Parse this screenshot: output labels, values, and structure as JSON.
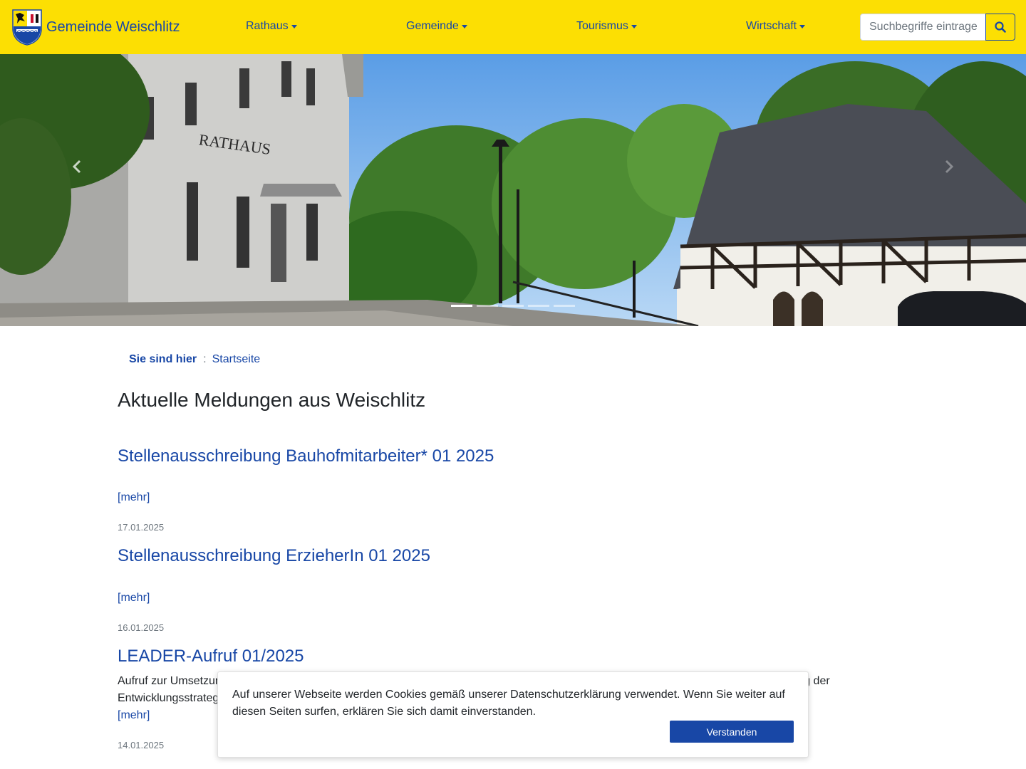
{
  "site": {
    "name": "Gemeinde Weischlitz"
  },
  "nav": {
    "items": [
      {
        "label": "Rathaus"
      },
      {
        "label": "Gemeinde"
      },
      {
        "label": "Tourismus"
      },
      {
        "label": "Wirtschaft"
      }
    ]
  },
  "search": {
    "placeholder": "Suchbegriffe eintragen",
    "icon": "search-icon"
  },
  "carousel": {
    "sign_text": "RATHAUS",
    "slide_count": 5,
    "active_slide": 1
  },
  "breadcrumb": {
    "label": "Sie sind hier",
    "separator": ":",
    "current": "Startseite"
  },
  "main": {
    "title": "Aktuelle Meldungen aus Weischlitz",
    "news": [
      {
        "title": "Stellenausschreibung Bauhofmitarbeiter* 01 2025",
        "text": "",
        "more": "[mehr]",
        "date": "17.01.2025"
      },
      {
        "title": "Stellenausschreibung ErzieherIn 01 2025",
        "text": "",
        "more": "[mehr]",
        "date": "16.01.2025"
      },
      {
        "title": "LEADER-Aufruf 01/2025",
        "text": "Aufruf zur Umsetzung von Vorhaben zur ländlichen Entwicklung. Die Lokale Aktionsgruppe Vogtland ruft auf, sich aktiv an der Umsetzung der Entwicklungsstrategie zu beteiligen.",
        "more": "[mehr]",
        "date": "14.01.2025"
      }
    ]
  },
  "cookie": {
    "text": "Auf unserer Webseite werden Cookies gemäß unserer Datenschutzerklärung verwendet. Wenn Sie weiter auf diesen Seiten surfen, erklären Sie sich damit einverstanden.",
    "button": "Verstanden"
  },
  "colors": {
    "navbar": "#fcdf03",
    "link": "#1847a6",
    "button": "#1847a6"
  }
}
